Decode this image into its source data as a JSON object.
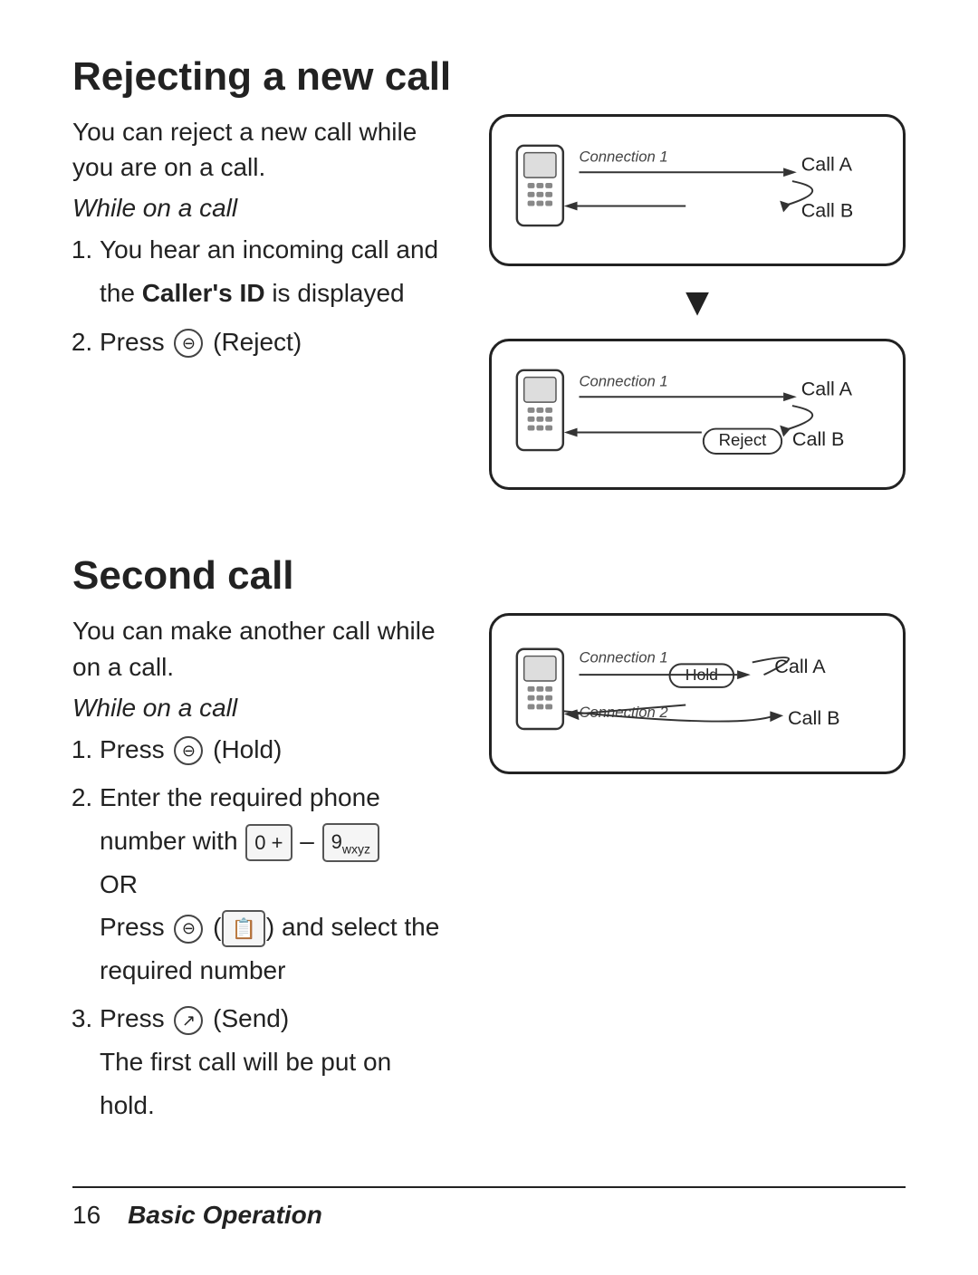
{
  "page": {
    "section1": {
      "title": "Rejecting a new call",
      "intro": "You can reject a new call while you are on a call.",
      "while_label": "While on a call",
      "steps": [
        "You hear an incoming call and the <b>Caller's ID</b> is displayed",
        "Press ⊖ (Reject)"
      ],
      "diagram1": {
        "connection_label": "Connection 1",
        "call_a": "Call A",
        "call_b": "Call B"
      },
      "diagram2": {
        "connection_label": "Connection 1",
        "call_a": "Call A",
        "reject_label": "Reject",
        "call_b": "Call B"
      }
    },
    "section2": {
      "title": "Second call",
      "intro": "You can make another call while on a call.",
      "while_label": "While on a call",
      "steps": [
        "Press ⊖ (Hold)",
        "Enter the required phone number with [0+] – [9wxyz] OR Press ⊖ ( [📋] ) and select the required number",
        "Press ↗ (Send)"
      ],
      "note": "The first call will be put on hold.",
      "diagram": {
        "connection1_label": "Connection 1",
        "connection2_label": "Connection 2",
        "hold_label": "Hold",
        "call_a": "Call A",
        "call_b": "Call B"
      }
    },
    "footer": {
      "page_number": "16",
      "section_title": "Basic Operation"
    }
  }
}
